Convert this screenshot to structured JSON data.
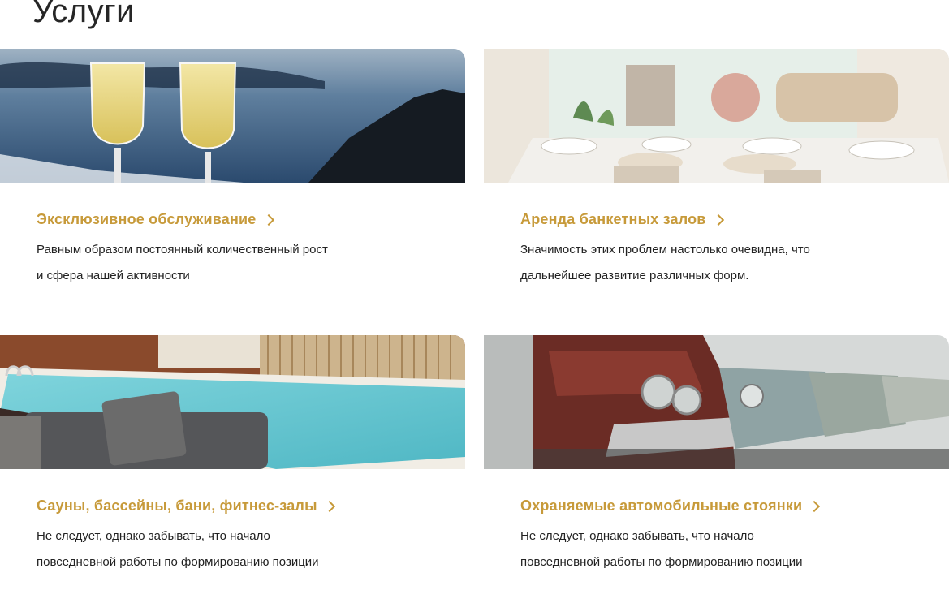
{
  "header": {
    "title": "Услуги"
  },
  "services": [
    {
      "title": "Эксклюзивное обслуживание",
      "desc_line1": "Равным образом постоянный количественный рост",
      "desc_line2": "и сфера нашей активности",
      "image": "champagne-glasses-sea-photo"
    },
    {
      "title": "Аренда банкетных залов",
      "desc_line1": "Значимость этих проблем настолько очевидна, что",
      "desc_line2": "дальнейшее развитие различных форм.",
      "image": "banquet-dining-room-photo"
    },
    {
      "title": "Сауны, бассейны, бани, фитнес-залы",
      "desc_line1": "Не следует, однако забывать, что начало",
      "desc_line2": "повседневной работы по формированию позиции",
      "image": "indoor-pool-lounge-photo"
    },
    {
      "title": "Охраняемые автомобильные стоянки",
      "desc_line1": "Не следует, однако забывать, что начало",
      "desc_line2": "повседневной работы по формированию позиции",
      "image": "vintage-cars-parking-photo"
    }
  ],
  "colors": {
    "accent": "#c79a3a",
    "text": "#222222",
    "title": "#262626"
  }
}
